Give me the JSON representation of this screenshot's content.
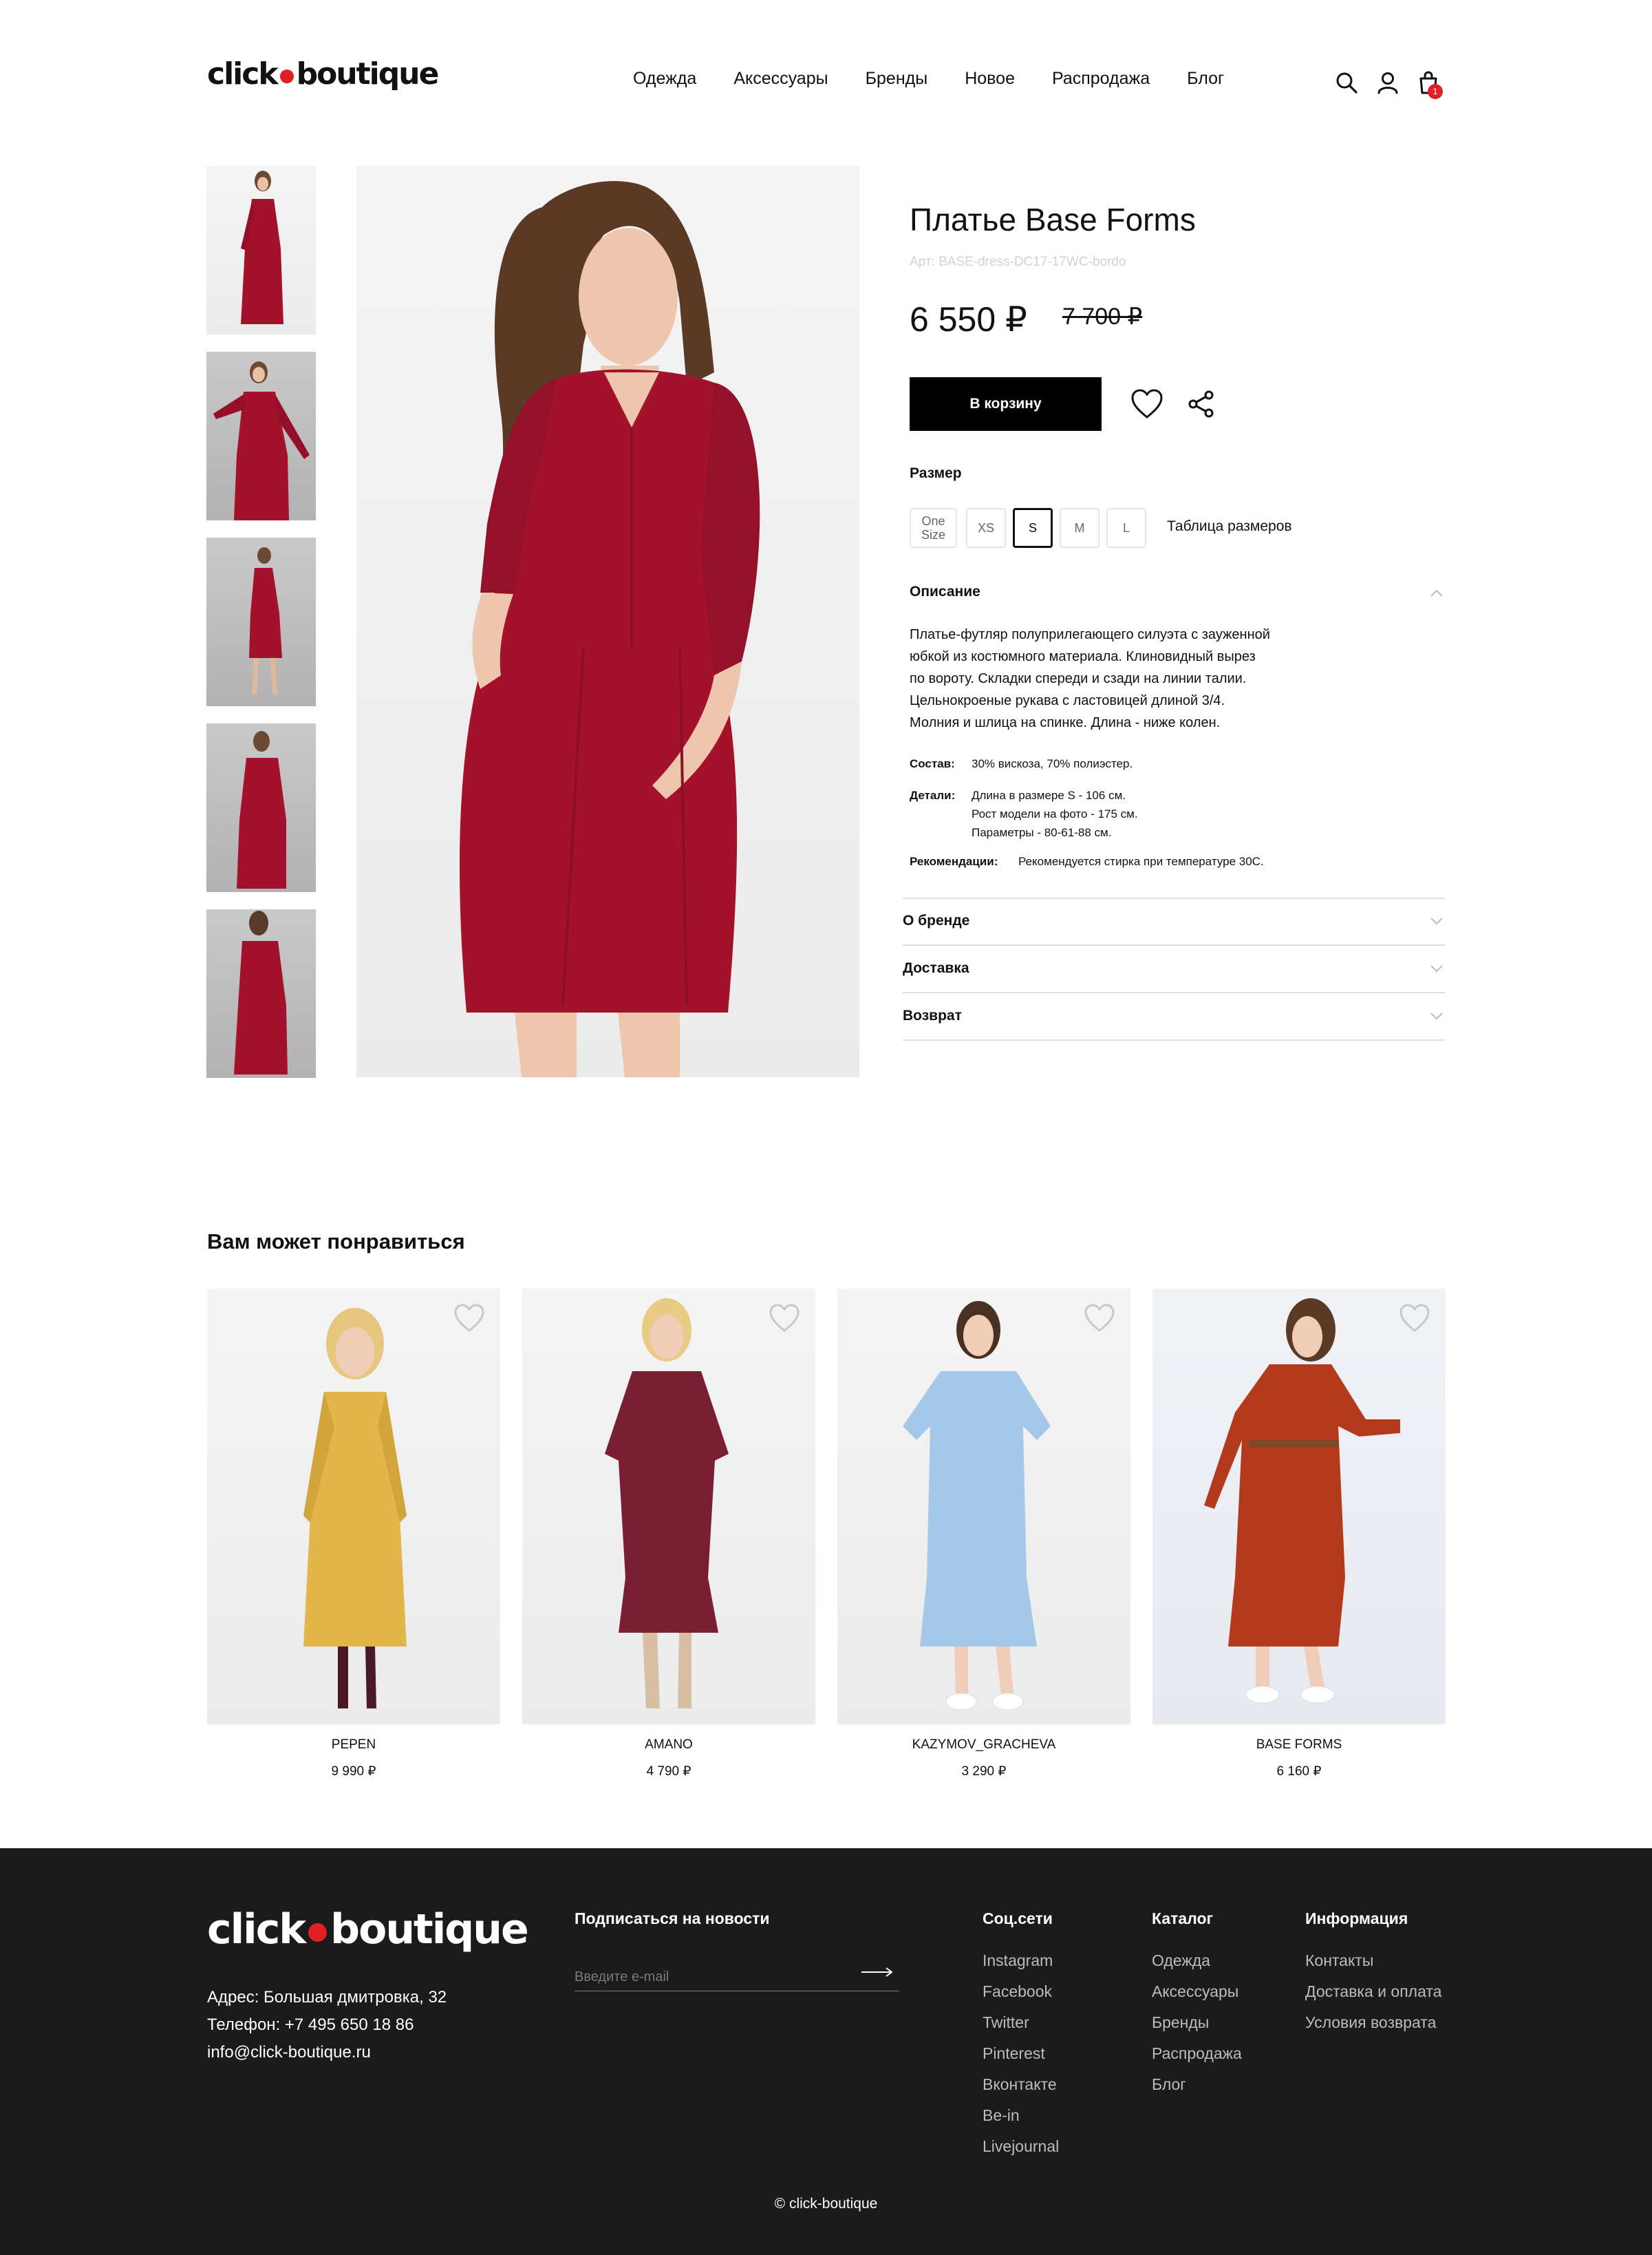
{
  "header": {
    "logo_left": "click",
    "logo_right": "boutique",
    "nav": [
      "Одежда",
      "Аксессуары",
      "Бренды",
      "Новое",
      "Распродажа",
      "Блог"
    ],
    "cart_count": "1",
    "icons": [
      "search-icon",
      "user-icon",
      "cart-icon"
    ]
  },
  "product": {
    "title": "Платье Base Forms",
    "sku": "Арт: BASE-dress-DC17-17WC-bordo",
    "price": "6 550 ₽",
    "old_price": "7 700 ₽",
    "add_to_cart": "В корзину",
    "size_label": "Размер",
    "sizes": [
      "One Size",
      "XS",
      "S",
      "M",
      "L"
    ],
    "selected_size": "S",
    "size_table": "Таблица размеров",
    "description_title": "Описание",
    "description_lines": [
      "Платье-футляр полуприлегающего силуэта с зауженной",
      "юбкой из костюмного материала. Клиновидный вырез",
      "по вороту. Складки спереди и сзади на линии талии.",
      "Цельнокроеные рукава с ластовицей длиной 3/4.",
      "Молния и шлица на спинке. Длина - ниже колен."
    ],
    "composition_label": "Состав:",
    "composition": "30% вискоза, 70% полиэстер.",
    "details_label": "Детали:",
    "details": [
      "Длина в размере S - 106 см.",
      "Рост модели на фото - 175 см.",
      "Параметры - 80-61-88 см."
    ],
    "recommend_label": "Рекомендации:",
    "recommend": "Рекомендуется стирка при температуре 30С.",
    "accordion": [
      "О бренде",
      "Доставка",
      "Возврат"
    ],
    "accent_color": "#a3122a"
  },
  "recommendations": {
    "title": "Вам может понравиться",
    "items": [
      {
        "brand": "PEPEN",
        "price": "9 990 ₽",
        "color": "#e2b64a"
      },
      {
        "brand": "AMANO",
        "price": "4 790 ₽",
        "color": "#7a1f33"
      },
      {
        "brand": "KAZYMOV_GRACHEVA",
        "price": "3 290 ₽",
        "color": "#a6c8e8"
      },
      {
        "brand": "BASE FORMS",
        "price": "6 160 ₽",
        "color": "#b33a1c"
      }
    ]
  },
  "footer": {
    "logo_left": "click",
    "logo_right": "boutique",
    "address": "Адрес: Большая дмитровка, 32",
    "phone": "Телефон: +7 495 650 18 86",
    "email": "info@click-boutique.ru",
    "subscribe_title": "Подписаться на новости",
    "email_placeholder": "Введите e-mail",
    "social_title": "Соц.сети",
    "social": [
      "Instagram",
      "Facebook",
      "Twitter",
      "Pinterest",
      "Вконтакте",
      "Be-in",
      "Livejournal"
    ],
    "catalog_title": "Каталог",
    "catalog": [
      "Одежда",
      "Аксессуары",
      "Бренды",
      "Распродажа",
      "Блог"
    ],
    "info_title": "Информация",
    "info": [
      "Контакты",
      "Доставка и оплата",
      "Условия возврата"
    ],
    "copyright": "© click-boutique"
  }
}
